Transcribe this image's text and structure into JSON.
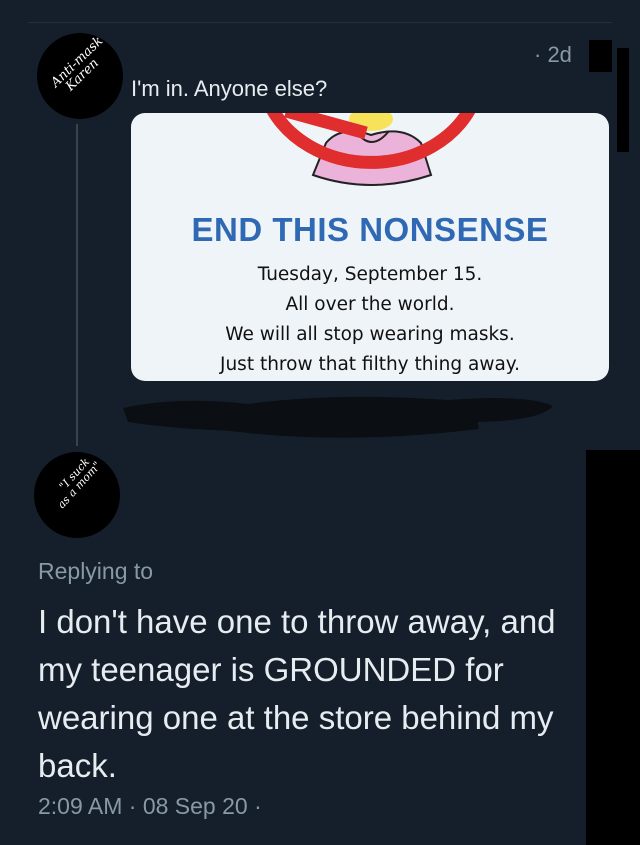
{
  "thread_tweet": {
    "avatar_text_line1": "Anti-mask",
    "avatar_text_line2": "Karen",
    "time_ago": "· 2d",
    "text": "I'm in. Anyone else?",
    "media": {
      "headline": "END THIS NONSENSE",
      "body_lines": [
        "Tuesday, September 15.",
        "All over the world.",
        "We will all stop wearing masks.",
        "Just throw that filthy thing away."
      ],
      "graphic_icon": "no-mask-prohibition-icon"
    }
  },
  "reply_tweet": {
    "avatar_text_line1": "\"I suck",
    "avatar_text_line2": "as a mom\"",
    "replying_to_label": "Replying to",
    "text": "I don't have one to throw away, and my teenager is GROUNDED for wearing one at the store behind my back.",
    "timestamp": "2:09 AM · 08 Sep 20 ·"
  },
  "colors": {
    "background": "#151f2b",
    "text_primary": "#e7ecf0",
    "text_secondary": "#8899a6",
    "headline_blue": "#2f68b3",
    "prohibition_red": "#e02d2d"
  }
}
